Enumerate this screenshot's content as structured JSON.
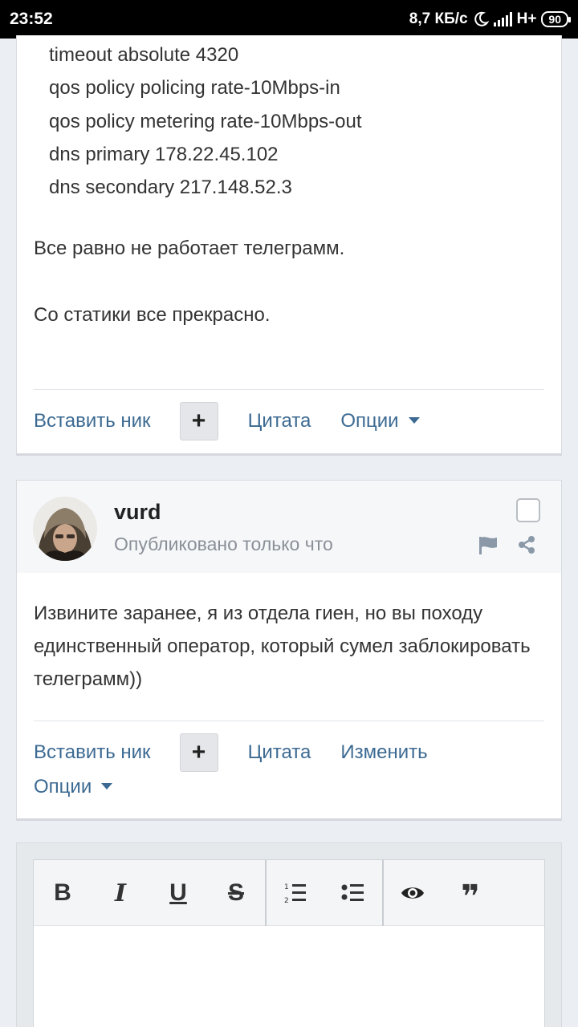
{
  "status_bar": {
    "time": "23:52",
    "speed": "8,7 КБ/с",
    "network": "H+",
    "battery": "90"
  },
  "post1": {
    "config_lines": [
      "timeout absolute 4320",
      "qos policy policing rate-10Mbps-in",
      "qos policy metering rate-10Mbps-out",
      "dns primary 178.22.45.102",
      "dns secondary 217.148.52.3"
    ],
    "text1": "Все равно не работает телеграмм.",
    "text2": "Со статики все прекрасно.",
    "actions": {
      "insert_nick": "Вставить ник",
      "plus": "+",
      "quote": "Цитата",
      "options": "Опции"
    }
  },
  "post2": {
    "author": "vurd",
    "posted": "Опубликовано только что",
    "body": "Извините заранее, я из отдела гиен, но вы походу единственный оператор, который сумел заблокировать телеграмм))",
    "actions": {
      "insert_nick": "Вставить ник",
      "plus": "+",
      "quote": "Цитата",
      "edit": "Изменить",
      "options": "Опции"
    }
  },
  "editor": {
    "bold": "B",
    "italic": "I",
    "underline": "U",
    "strike": "S",
    "quote_glyph": "❞"
  },
  "icons": [
    "moon-icon",
    "signal-icon",
    "battery-icon",
    "caret-down-icon",
    "flag-icon",
    "share-icon",
    "ordered-list-icon",
    "bullet-list-icon",
    "preview-eye-icon",
    "quote-icon"
  ],
  "colors": {
    "link": "#3c6a92",
    "muted": "#8a9098",
    "page_bg": "#ebeef2"
  }
}
